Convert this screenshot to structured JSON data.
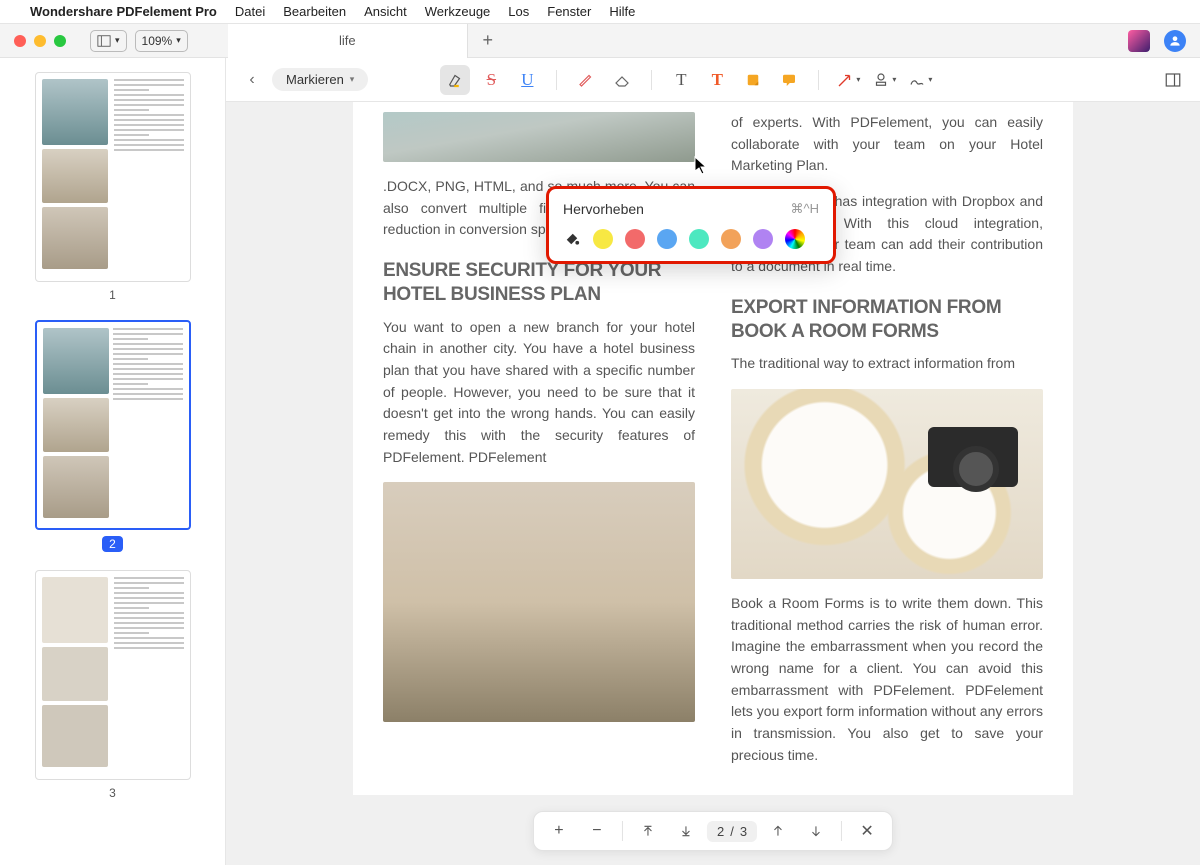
{
  "menubar": {
    "items": [
      "Wondershare PDFelement Pro",
      "Datei",
      "Bearbeiten",
      "Ansicht",
      "Werkzeuge",
      "Los",
      "Fenster",
      "Hilfe"
    ]
  },
  "titlebar": {
    "zoom_value": "109%",
    "tab_label": "life",
    "tab_add": "+"
  },
  "toolbar": {
    "back_glyph": "‹",
    "mark_label": "Markieren",
    "icons": {
      "highlight": "highlight-icon",
      "strike": "S",
      "underline": "U",
      "draw": "draw",
      "erase": "erase",
      "text_t": "T",
      "text_orange": "T",
      "note": "note",
      "comment": "comment",
      "arrow": "arrow",
      "stamp": "stamp",
      "sign": "sign",
      "panel": "panel"
    }
  },
  "popup": {
    "title": "Hervorheben",
    "shortcut": "⌘^H",
    "colors": [
      "#f7e843",
      "#f26a6a",
      "#5aa6f2",
      "#4de8c0",
      "#f2a25a",
      "#b083f2",
      "rainbow"
    ]
  },
  "sidebar": {
    "thumbs": [
      {
        "num": "1",
        "selected": false
      },
      {
        "num": "2",
        "selected": true
      },
      {
        "num": "3",
        "selected": false
      }
    ]
  },
  "document": {
    "left_col": {
      "intro_tail": ".DOCX, PNG, HTML, and so much more. You can also convert multiple files at once with no reduction in conversion speed.",
      "h1": "ENSURE SECURITY FOR YOUR HOTEL BUSINESS PLAN",
      "p1": "You want to open a new branch for your hotel chain in another city. You have a hotel business plan that you have shared with a specific number of people. However, you need to be sure that it doesn't get into the wrong hands. You can easily remedy this with the security features of PDFelement. PDFelement"
    },
    "right_col": {
      "p0": "of experts. With PDFelement, you can easily collaborate with your team on your Hotel Marketing Plan.",
      "p0b": "PDFelement has integration with Dropbox and Google Drive. With this cloud integration, members of your team can add their contribution to a document in real time.",
      "h1": "EXPORT INFORMATION FROM BOOK A ROOM FORMS",
      "p1": "The traditional way to extract information from",
      "p2": "Book a Room Forms is to write them down. This traditional method carries the risk of human error. Imagine the embarrassment when you record the wrong name for a client. You can avoid this embarrassment with PDFelement. PDFelement lets you export form information without any errors in transmission. You also get to save your precious time."
    }
  },
  "footer": {
    "plus": "+",
    "minus": "−",
    "page_current": "2",
    "page_sep": "/",
    "page_total": "3",
    "close": "✕"
  }
}
